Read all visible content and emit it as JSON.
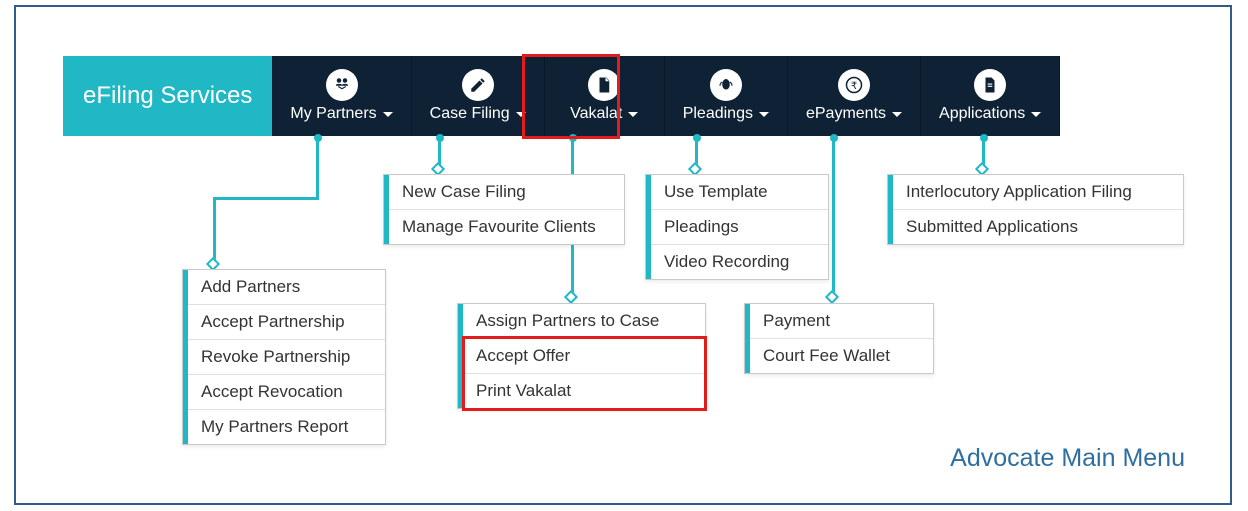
{
  "brand": "eFiling Services",
  "nav": [
    {
      "label": "My Partners"
    },
    {
      "label": "Case Filing"
    },
    {
      "label": "Vakalat"
    },
    {
      "label": "Pleadings"
    },
    {
      "label": "ePayments"
    },
    {
      "label": "Applications"
    }
  ],
  "dropdowns": {
    "partners": [
      "Add Partners",
      "Accept Partnership",
      "Revoke Partnership",
      "Accept Revocation",
      "My Partners Report"
    ],
    "casefiling": [
      "New Case Filing",
      "Manage Favourite Clients"
    ],
    "vakalat": [
      "Assign Partners to Case",
      "Accept Offer",
      "Print Vakalat"
    ],
    "pleadings": [
      "Use Template",
      "Pleadings",
      "Video Recording"
    ],
    "epayments": [
      "Payment",
      "Court Fee Wallet"
    ],
    "applications": [
      "Interlocutory Application Filing",
      "Submitted Applications"
    ]
  },
  "footer": "Advocate Main Menu"
}
